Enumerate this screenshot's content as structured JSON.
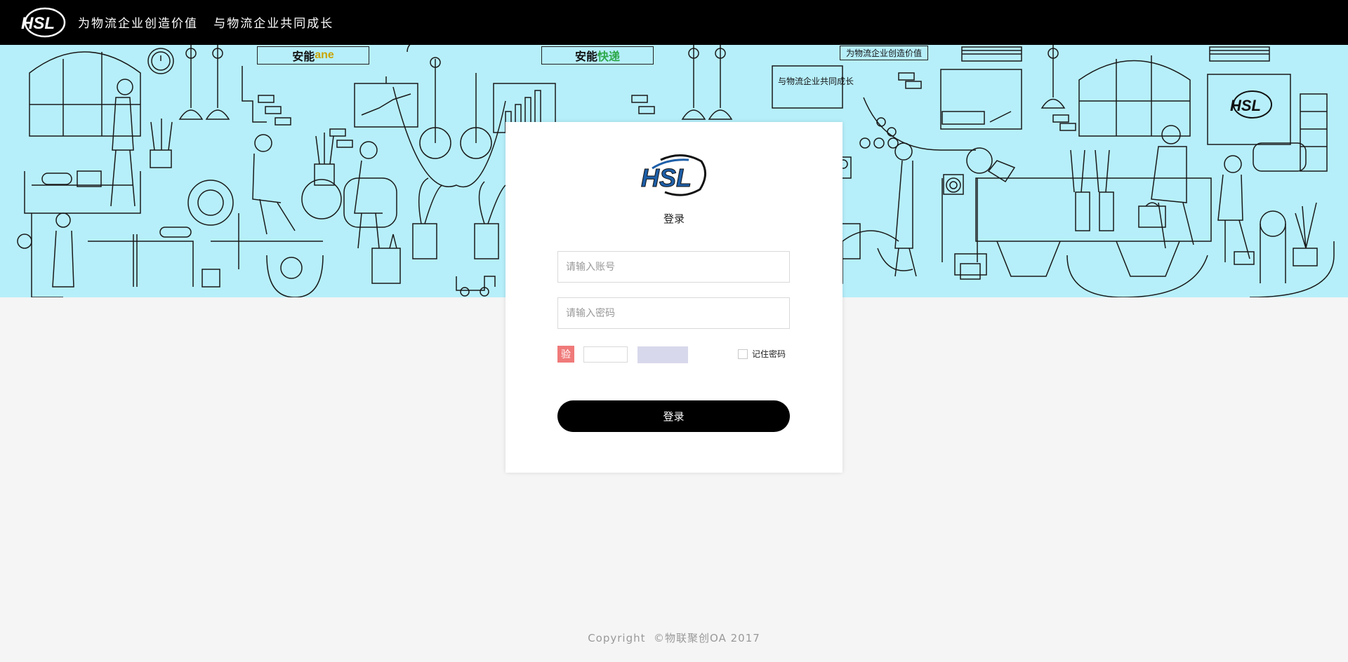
{
  "header": {
    "logo_text": "HSL",
    "slogan": "为物流企业创造价值   与物流企业共同成长"
  },
  "banner": {
    "brand_sign_1": {
      "main": "安能",
      "accent": "ane"
    },
    "brand_sign_2": {
      "main": "安能",
      "accent": "快递"
    },
    "wall_sign_1": "为物流企业创造价值",
    "wall_sign_2": "与物流企业共同成长",
    "poster_logo_text": "HSL"
  },
  "login": {
    "logo_text": "HSL",
    "title": "登录",
    "account_placeholder": "请输入账号",
    "password_placeholder": "请输入密码",
    "captcha_badge": "验",
    "remember_label": "记住密码",
    "submit_label": "登录"
  },
  "footer": {
    "copyright": "Copyright  ©物联聚创OA 2017"
  },
  "colors": {
    "top_bar": "#000000",
    "banner_bg": "#b6effa",
    "page_bg": "#f5f5f5",
    "button": "#000000",
    "captcha_badge": "#f07a7a",
    "captcha_image": "#d8d8ec",
    "logo_blue": "#1e5fa8"
  }
}
